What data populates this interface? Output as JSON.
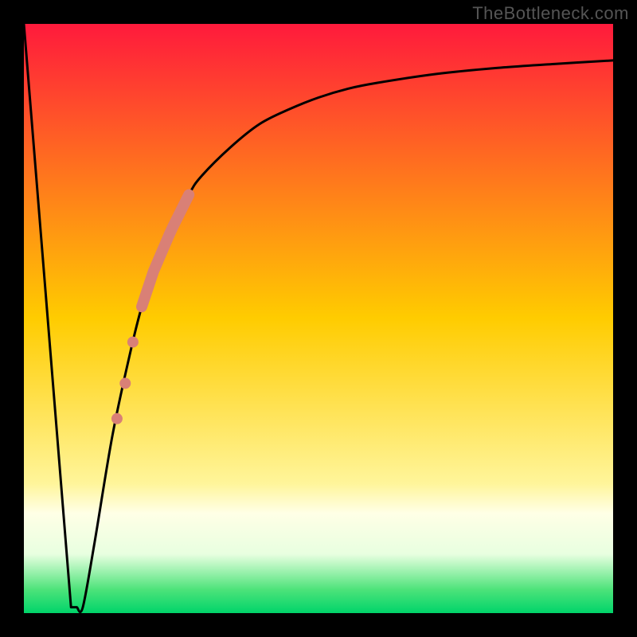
{
  "attribution": "TheBottleneck.com",
  "chart_data": {
    "type": "line",
    "title": "",
    "xlabel": "",
    "ylabel": "",
    "xlim": [
      0,
      100
    ],
    "ylim": [
      0,
      100
    ],
    "gradient_stops": [
      {
        "offset": 0.0,
        "color": "#ff1a3c"
      },
      {
        "offset": 0.5,
        "color": "#ffcc00"
      },
      {
        "offset": 0.78,
        "color": "#fff59a"
      },
      {
        "offset": 0.83,
        "color": "#ffffe6"
      },
      {
        "offset": 0.9,
        "color": "#e8ffe0"
      },
      {
        "offset": 0.96,
        "color": "#4de37a"
      },
      {
        "offset": 1.0,
        "color": "#00d46a"
      }
    ],
    "curve": {
      "comment": "V-shaped bottleneck curve; y = approximate bottleneck percentage",
      "x": [
        0,
        8,
        9,
        10,
        12,
        15,
        18,
        20,
        22,
        25,
        28,
        30,
        35,
        40,
        45,
        50,
        55,
        60,
        70,
        80,
        90,
        100
      ],
      "y": [
        100,
        1,
        1,
        1,
        12,
        30,
        44,
        52,
        58,
        65,
        71,
        74,
        79,
        83,
        85.5,
        87.5,
        89,
        90,
        91.5,
        92.5,
        93.2,
        93.8
      ]
    },
    "highlight_band": {
      "comment": "thick salmon segment on rising arm",
      "x_range": [
        20,
        28
      ],
      "color": "#d98076"
    },
    "highlight_dots": {
      "points": [
        {
          "x": 18.5,
          "y": 46
        },
        {
          "x": 17.2,
          "y": 39
        },
        {
          "x": 15.8,
          "y": 33
        }
      ],
      "color": "#d98076"
    },
    "flat_bottom": {
      "x_range": [
        8,
        10
      ],
      "y": 1
    }
  }
}
